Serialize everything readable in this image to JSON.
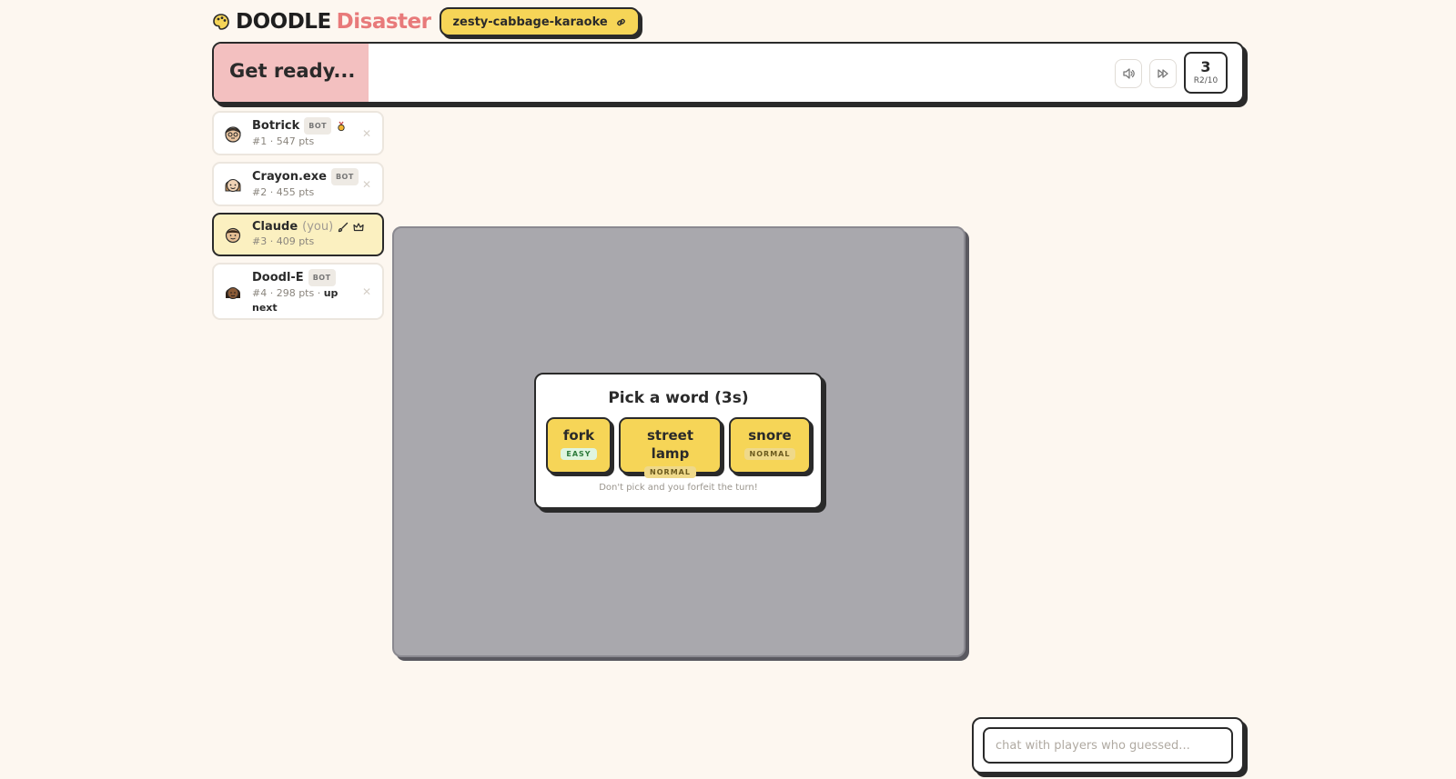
{
  "header": {
    "logo_word1": "DOODLE",
    "logo_word2": "Disaster",
    "room_code": "zesty-cabbage-karaoke",
    "colors": {
      "accent_yellow": "#f6d557",
      "brand_red": "#e87a7a"
    }
  },
  "status": {
    "text": "Get ready...",
    "timer_fraction": 0.15,
    "round_number": "3",
    "round_label": "R2/10"
  },
  "players": [
    {
      "name": "Botrick",
      "bot_label": "BOT",
      "meta": "#1 · 547 pts",
      "extra": "",
      "you_label": "",
      "icon": "medal-icon"
    },
    {
      "name": "Crayon.exe",
      "bot_label": "BOT",
      "meta": "#2 · 455 pts",
      "extra": "",
      "you_label": "",
      "icon": ""
    },
    {
      "name": "Claude",
      "bot_label": "",
      "meta": "#3 · 409 pts",
      "extra": "",
      "you_label": "(you)",
      "icon": "brush-icon crown-icon"
    },
    {
      "name": "Doodl-E",
      "bot_label": "BOT",
      "meta": "#4 · 298 pts · ",
      "extra": "up next",
      "you_label": "",
      "icon": ""
    }
  ],
  "picker": {
    "title": "Pick a word (3s)",
    "choices": [
      {
        "word": "fork",
        "difficulty": "EASY"
      },
      {
        "word": "street lamp",
        "difficulty": "NORMAL"
      },
      {
        "word": "snore",
        "difficulty": "NORMAL"
      }
    ],
    "note": "Don't pick and you forfeit the turn!"
  },
  "chat": {
    "placeholder": "chat with players who guessed..."
  }
}
